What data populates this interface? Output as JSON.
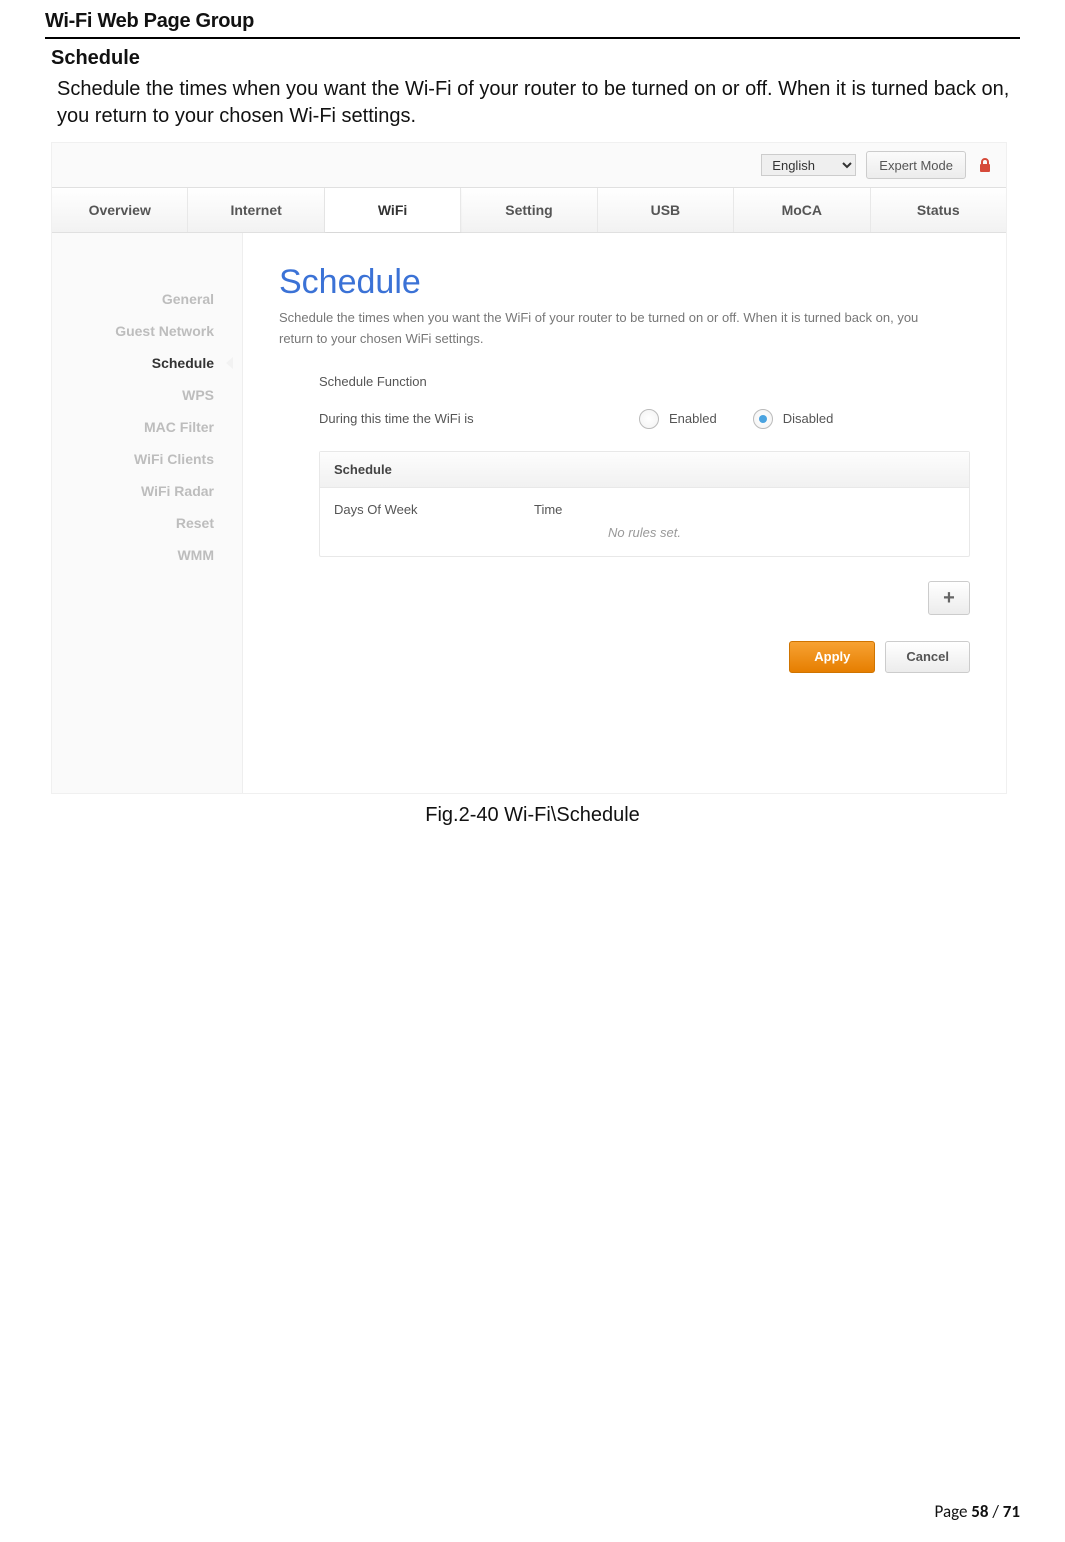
{
  "doc": {
    "group_title": "Wi-Fi Web Page Group",
    "sub_title": "Schedule",
    "intro": "Schedule the times when you want the Wi-Fi of your router to be turned on or off. When it is turned back on, you return to your chosen Wi-Fi settings.",
    "caption": "Fig.2-40 Wi-Fi\\Schedule",
    "footer_prefix": "Page ",
    "footer_page": "58",
    "footer_sep": " / ",
    "footer_total": "71"
  },
  "topbar": {
    "language": "English",
    "expert_label": "Expert Mode"
  },
  "main_tabs": {
    "items": [
      "Overview",
      "Internet",
      "WiFi",
      "Setting",
      "USB",
      "MoCA",
      "Status"
    ],
    "active_index": 2
  },
  "sidebar": {
    "items": [
      "General",
      "Guest Network",
      "Schedule",
      "WPS",
      "MAC Filter",
      "WiFi Clients",
      "WiFi Radar",
      "Reset",
      "WMM"
    ],
    "active_index": 2
  },
  "panel": {
    "title": "Schedule",
    "desc": "Schedule the times when you want the WiFi of your router to be turned on or off. When it is turned back on, you return to your chosen WiFi settings.",
    "form": {
      "function_label": "Schedule Function",
      "during_label": "During this time the WiFi is",
      "enabled_label": "Enabled",
      "disabled_label": "Disabled",
      "selected": "Disabled"
    },
    "schedule": {
      "header": "Schedule",
      "col_day": "Days Of Week",
      "col_time": "Time",
      "empty": "No rules set.",
      "add_label": "+"
    },
    "actions": {
      "apply": "Apply",
      "cancel": "Cancel"
    }
  }
}
